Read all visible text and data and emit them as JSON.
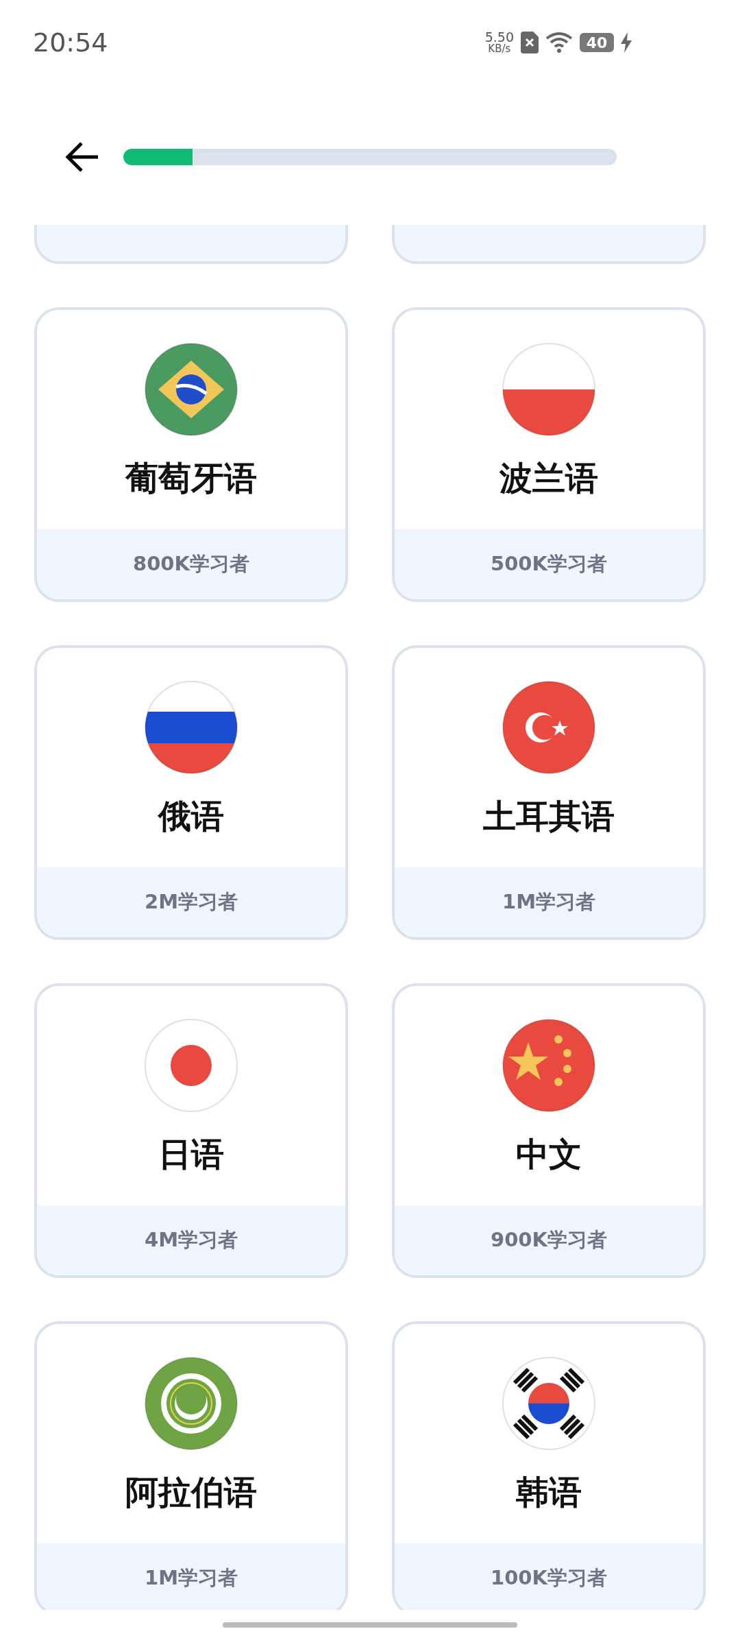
{
  "status_bar": {
    "time": "20:54",
    "speed_value": "5.50",
    "speed_unit": "KB/s",
    "battery": "40"
  },
  "progress": {
    "level": 0.14
  },
  "cards": [
    {
      "kind": "partial"
    },
    {
      "kind": "partial"
    },
    {
      "kind": "brazil",
      "name": "葡萄牙语",
      "learners": "800K学习者"
    },
    {
      "kind": "poland",
      "name": "波兰语",
      "learners": "500K学习者"
    },
    {
      "kind": "russia",
      "name": "俄语",
      "learners": "2M学习者"
    },
    {
      "kind": "turkey",
      "name": "土耳其语",
      "learners": "1M学习者"
    },
    {
      "kind": "japan",
      "name": "日语",
      "learners": "4M学习者"
    },
    {
      "kind": "china",
      "name": "中文",
      "learners": "900K学习者"
    },
    {
      "kind": "arab",
      "name": "阿拉伯语",
      "learners": "1M学习者"
    },
    {
      "kind": "korea",
      "name": "韩语",
      "learners": "100K学习者"
    }
  ]
}
